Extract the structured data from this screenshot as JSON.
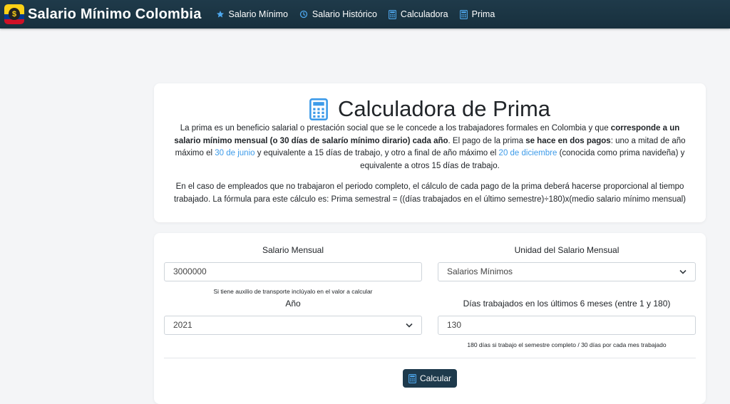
{
  "navbar": {
    "brand": "Salario Mínimo Colombia",
    "brand_logo_glyph": "$",
    "items": [
      {
        "label": "Salario Mínimo",
        "icon": "star-icon"
      },
      {
        "label": "Salario Histórico",
        "icon": "clock-icon"
      },
      {
        "label": "Calculadora",
        "icon": "calculator-icon"
      },
      {
        "label": "Prima",
        "icon": "calculator-icon"
      }
    ]
  },
  "info": {
    "title": "Calculadora de Prima",
    "p1": [
      {
        "text": "La prima es un beneficio salarial o prestación social que se le concede a los trabajadores formales en Colombia y que ",
        "style": "normal"
      },
      {
        "text": "corresponde a un salario mínimo mensual (o 30 días de salarío mínimo dirario) cada año",
        "style": "bold"
      },
      {
        "text": ". El pago de la prima ",
        "style": "normal"
      },
      {
        "text": "se hace en dos pagos",
        "style": "bold"
      },
      {
        "text": ": uno a mitad de año máximo el ",
        "style": "normal"
      },
      {
        "text": "30 de junio",
        "style": "link"
      },
      {
        "text": " y equivalente a 15 días de trabajo, y otro a final de año máximo el ",
        "style": "normal"
      },
      {
        "text": "20 de diciembre",
        "style": "link"
      },
      {
        "text": " (conocida como prima navideña) y equivalente a otros 15 días de trabajo.",
        "style": "normal"
      }
    ],
    "p2": "En el caso de empleados que no trabajaron el periodo completo, el cálculo de cada pago de la prima deberá hacerse proporcional al tiempo trabajado. La fórmula para este cálculo es: Prima semestral = ((días trabajados en el último semestre)÷180)x(medio salario mínimo mensual)"
  },
  "form": {
    "salario": {
      "label": "Salario Mensual",
      "value": "3000000",
      "help": "Si tiene auxilio de transporte inclúyalo en el valor a calcular"
    },
    "unidad": {
      "label": "Unidad del Salario Mensual",
      "selected": "Salarios Mínimos"
    },
    "anio": {
      "label": "Año",
      "selected": "2021"
    },
    "dias": {
      "label": "Días trabajados en los últimos 6 meses (entre 1 y 180)",
      "value": "130",
      "help": "180 días si trabajo el semestre completo / 30 días por cada mes trabajado"
    },
    "submit_label": "Calcular"
  },
  "colors": {
    "navbar": "#1f3a4a",
    "link": "#3d9be9",
    "icon_blue": "#3d9be9",
    "button": "#1e3a4c",
    "page_bg": "#f4f5f7"
  }
}
